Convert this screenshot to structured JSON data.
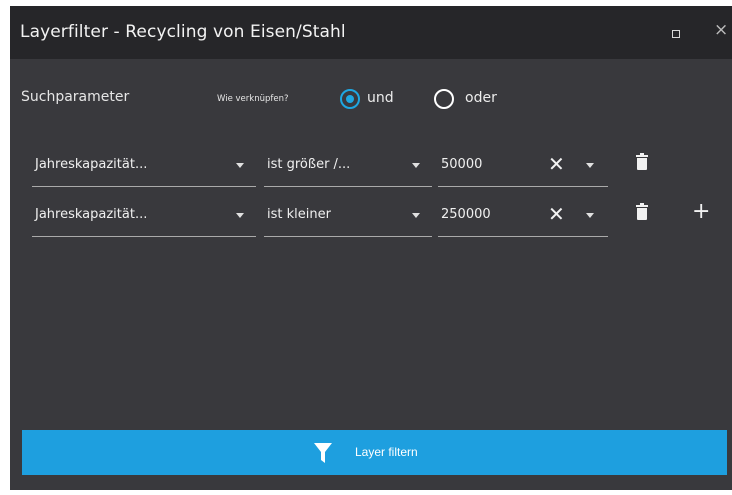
{
  "window": {
    "title": "Layerfilter - Recycling von Eisen/Stahl",
    "restore_icon": "restore-icon",
    "close_glyph": "×"
  },
  "search": {
    "label": "Suchparameter",
    "link_question": "Wie verknüpfen?",
    "options": [
      {
        "label": "und",
        "selected": true
      },
      {
        "label": "oder",
        "selected": false
      }
    ]
  },
  "filters": [
    {
      "attribute": "Jahreskapazität...",
      "operator": "ist größer /...",
      "value": "50000",
      "clear": "✕",
      "delete_icon": "trash-icon"
    },
    {
      "attribute": "Jahreskapazität...",
      "operator": "ist kleiner",
      "value": "250000",
      "clear": "✕",
      "delete_icon": "trash-icon",
      "add": "+"
    }
  ],
  "apply": {
    "label": "Layer filtern",
    "icon": "funnel-icon"
  },
  "colors": {
    "accent": "#1e9fdf",
    "panel": "#39393d",
    "titlebar": "#262629"
  }
}
